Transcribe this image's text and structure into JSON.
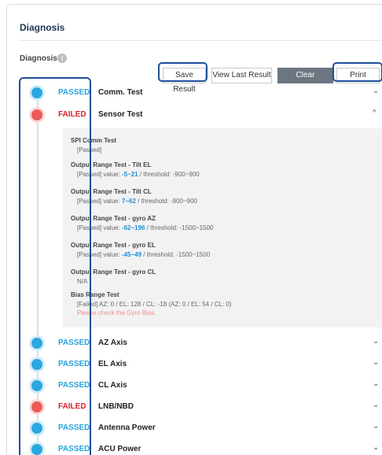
{
  "header": {
    "title": "Diagnosis"
  },
  "section": {
    "label": "Diagnosis",
    "info_icon": "info-icon",
    "info_glyph": "!"
  },
  "toolbar": {
    "save_label": "Save Result",
    "view_last_label": "View Last Result",
    "clear_label": "Clear Diagnosis",
    "print_label": "Print"
  },
  "colors": {
    "passed": "#29a8e0",
    "failed": "#ec5a5a",
    "highlight": "#1f4e9c"
  },
  "items": [
    {
      "status": "PASSED",
      "name": "Comm. Test",
      "expanded": false
    },
    {
      "status": "FAILED",
      "name": "Sensor Test",
      "expanded": true
    },
    {
      "status": "PASSED",
      "name": "AZ Axis",
      "expanded": false
    },
    {
      "status": "PASSED",
      "name": "EL Axis",
      "expanded": false
    },
    {
      "status": "PASSED",
      "name": "CL Axis",
      "expanded": false
    },
    {
      "status": "FAILED",
      "name": "LNB/NBD",
      "expanded": false
    },
    {
      "status": "PASSED",
      "name": "Antenna Power",
      "expanded": false
    },
    {
      "status": "PASSED",
      "name": "ACU Power",
      "expanded": false
    }
  ],
  "chevrons": {
    "collapsed": "⌄",
    "expanded": "^"
  },
  "sensor_details": [
    {
      "title": "SPI Comm Test",
      "result": "[Passed]"
    },
    {
      "title": "Output Range Test - Tilt EL",
      "result_prefix": "[Passed] value: ",
      "value": "-5~21",
      "result_suffix": " / threshold: -900~900"
    },
    {
      "title": "Output Range Test - Tilt CL",
      "result_prefix": "[Passed] value: ",
      "value": "7~62",
      "result_suffix": " / threshold: -900~900"
    },
    {
      "title": "Output Range Test - gyro AZ",
      "result_prefix": "[Passed] value: ",
      "value": "-62~196",
      "result_suffix": " / threshold: -1500~1500"
    },
    {
      "title": "Output Range Test - gyro EL",
      "result_prefix": "[Passed] value: ",
      "value": "-45~49",
      "result_suffix": " / threshold: -1500~1500"
    },
    {
      "title": "Output Range Test - gyro CL",
      "result": "N/A"
    },
    {
      "title": "Bias Range Test",
      "result": "[Failed] AZ: 0 / EL: 128 / CL: -18 (AZ: 0 / EL: 54 / CL: 0)",
      "warning": "Please check the Gyro Bias."
    }
  ]
}
